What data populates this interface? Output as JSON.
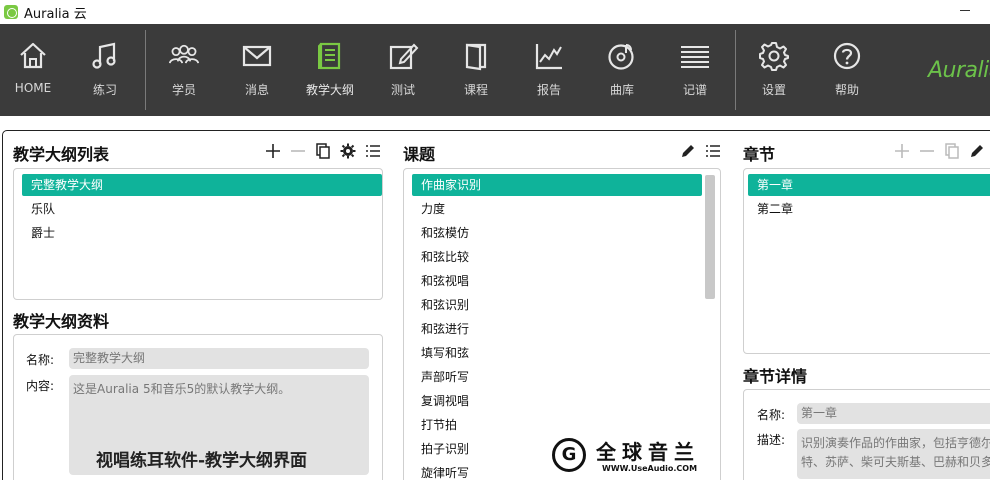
{
  "window": {
    "title": "Auralia 云"
  },
  "toolbar": {
    "brand": "Auralia",
    "items": [
      {
        "label": "HOME",
        "icon": "home-icon"
      },
      {
        "label": "练习",
        "icon": "music-note-icon"
      },
      {
        "label": "学员",
        "icon": "students-icon"
      },
      {
        "label": "消息",
        "icon": "mail-icon"
      },
      {
        "label": "教学大纲",
        "icon": "syllabus-icon",
        "active": true
      },
      {
        "label": "测试",
        "icon": "edit-test-icon"
      },
      {
        "label": "课程",
        "icon": "course-book-icon"
      },
      {
        "label": "报告",
        "icon": "report-chart-icon"
      },
      {
        "label": "曲库",
        "icon": "music-library-icon"
      },
      {
        "label": "记谱",
        "icon": "notation-icon"
      },
      {
        "label": "设置",
        "icon": "gear-icon"
      },
      {
        "label": "帮助",
        "icon": "help-icon"
      }
    ],
    "active_color": "#7ac943"
  },
  "syllabus_list": {
    "title": "教学大纲列表",
    "items": [
      "完整教学大纲",
      "乐队",
      "爵士"
    ],
    "selected_index": 0
  },
  "syllabus_info": {
    "title": "教学大纲资料",
    "name_label": "名称:",
    "name_value": "完整教学大纲",
    "content_label": "内容:",
    "content_value": "这是Auralia 5和音乐5的默认教学大纲。"
  },
  "topics": {
    "title": "课题",
    "items": [
      "作曲家识别",
      "力度",
      "和弦模仿",
      "和弦比较",
      "和弦视唱",
      "和弦识别",
      "和弦进行",
      "填写和弦",
      "声部听写",
      "复调视唱",
      "打节拍",
      "拍子识别",
      "旋律听写"
    ],
    "selected_index": 0
  },
  "chapters": {
    "title": "章节",
    "items": [
      "第一章",
      "第二章"
    ],
    "selected_index": 0
  },
  "chapter_details": {
    "title": "章节详情",
    "name_label": "名称:",
    "name_value": "第一章",
    "desc_label": "描述:",
    "desc_line1": "识别演奏作品的作曲家，包括亨德尔",
    "desc_line2": "特、苏萨、柴可夫斯基、巴赫和贝多"
  },
  "overlay": {
    "caption": "视唱练耳软件-教学大纲界面",
    "watermark_letter": "G",
    "watermark_text": "全球音兰",
    "watermark_url": "WWW.UseAudio.COM"
  },
  "colors": {
    "selection": "#0fb39a",
    "toolbar_bg": "#3b3b3b",
    "brand": "#6cc24a"
  }
}
